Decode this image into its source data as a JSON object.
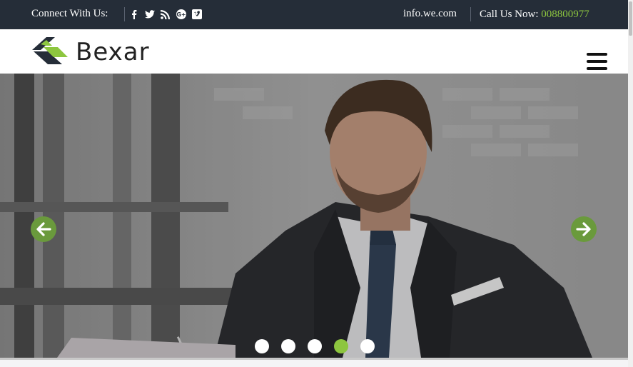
{
  "topbar": {
    "connect_label": "Connect With Us:",
    "socials": [
      "facebook-icon",
      "twitter-icon",
      "rss-icon",
      "google-plus-icon",
      "vimeo-icon"
    ],
    "email": "info.we.com",
    "call_label": "Call Us Now:",
    "phone": "008800977"
  },
  "header": {
    "brand": "Bexar",
    "menu_icon": "hamburger-menu-icon"
  },
  "slider": {
    "prev_icon": "arrow-left-icon",
    "next_icon": "arrow-right-icon",
    "slide_count": 5,
    "active_slide": 4
  },
  "colors": {
    "topbar_bg": "#252d38",
    "accent_green": "#8dc63f",
    "arrow_green": "#6a9a3c"
  }
}
